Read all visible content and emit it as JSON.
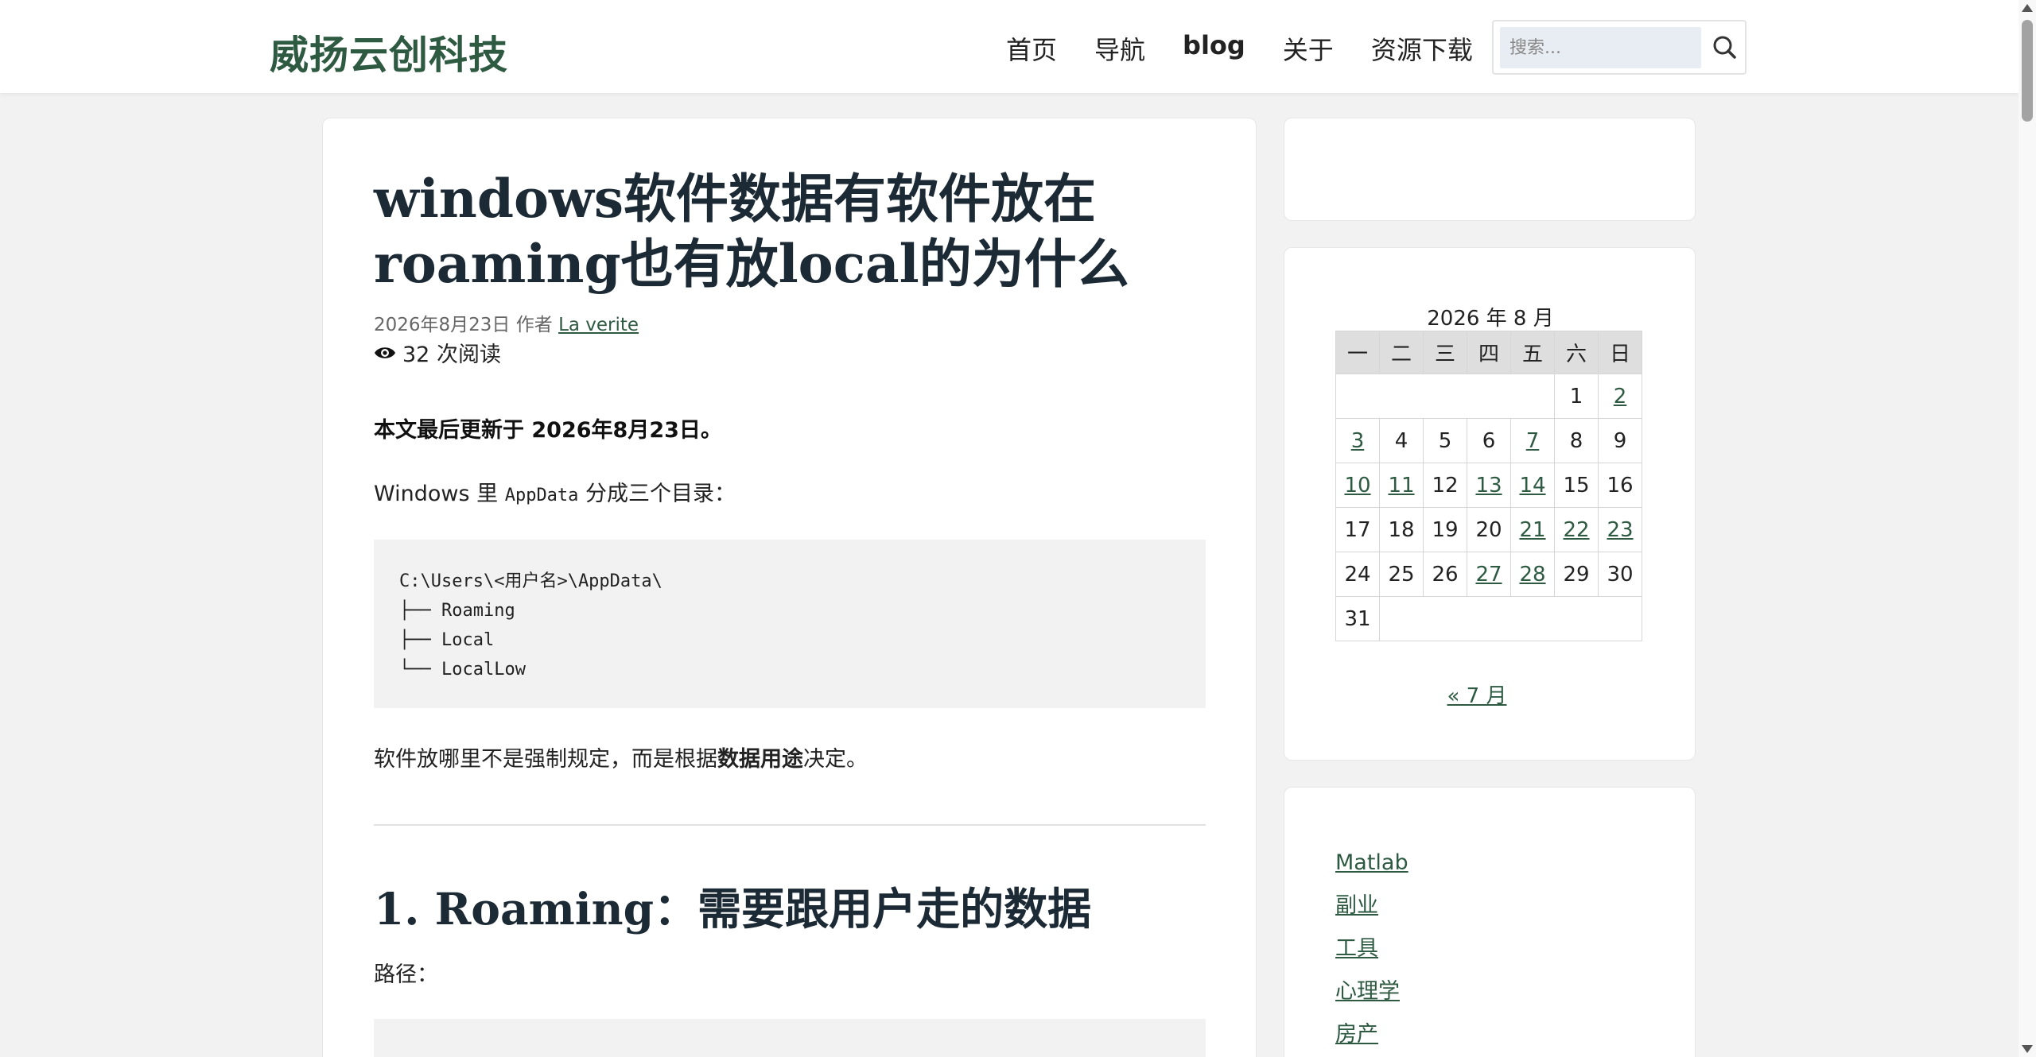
{
  "header": {
    "logo": "威扬云创科技",
    "nav": [
      {
        "label": "首页",
        "bold": false
      },
      {
        "label": "导航",
        "bold": false
      },
      {
        "label": "blog",
        "bold": true
      },
      {
        "label": "关于",
        "bold": false
      },
      {
        "label": "资源下载",
        "bold": false
      }
    ],
    "search_placeholder": "搜索..."
  },
  "article": {
    "title_line1": "windows软件数据有软件放在",
    "title_line2": "roaming也有放local的为什么",
    "date": "2026年8月23日",
    "author_prefix": "作者",
    "author": "La verite",
    "views": "32 次阅读",
    "updated": "本文最后更新于 2026年8月23日。",
    "intro_before": "Windows 里 ",
    "intro_code": "AppData",
    "intro_after": " 分成三个目录：",
    "code1": "C:\\Users\\<用户名>\\AppData\\\n├── Roaming\n├── Local\n└── LocalLow",
    "p3_before": "软件放哪里不是强制规定，而是根据",
    "p3_bold": "数据用途",
    "p3_after": "决定。",
    "h2": "1. Roaming：需要跟用户走的数据",
    "p4": "路径："
  },
  "calendar": {
    "caption": "2026 年 8 月",
    "weekdays": [
      "一",
      "二",
      "三",
      "四",
      "五",
      "六",
      "日"
    ],
    "prev": "« 7 月"
  },
  "categories": [
    "Matlab",
    "副业",
    "工具",
    "心理学",
    "房产"
  ]
}
